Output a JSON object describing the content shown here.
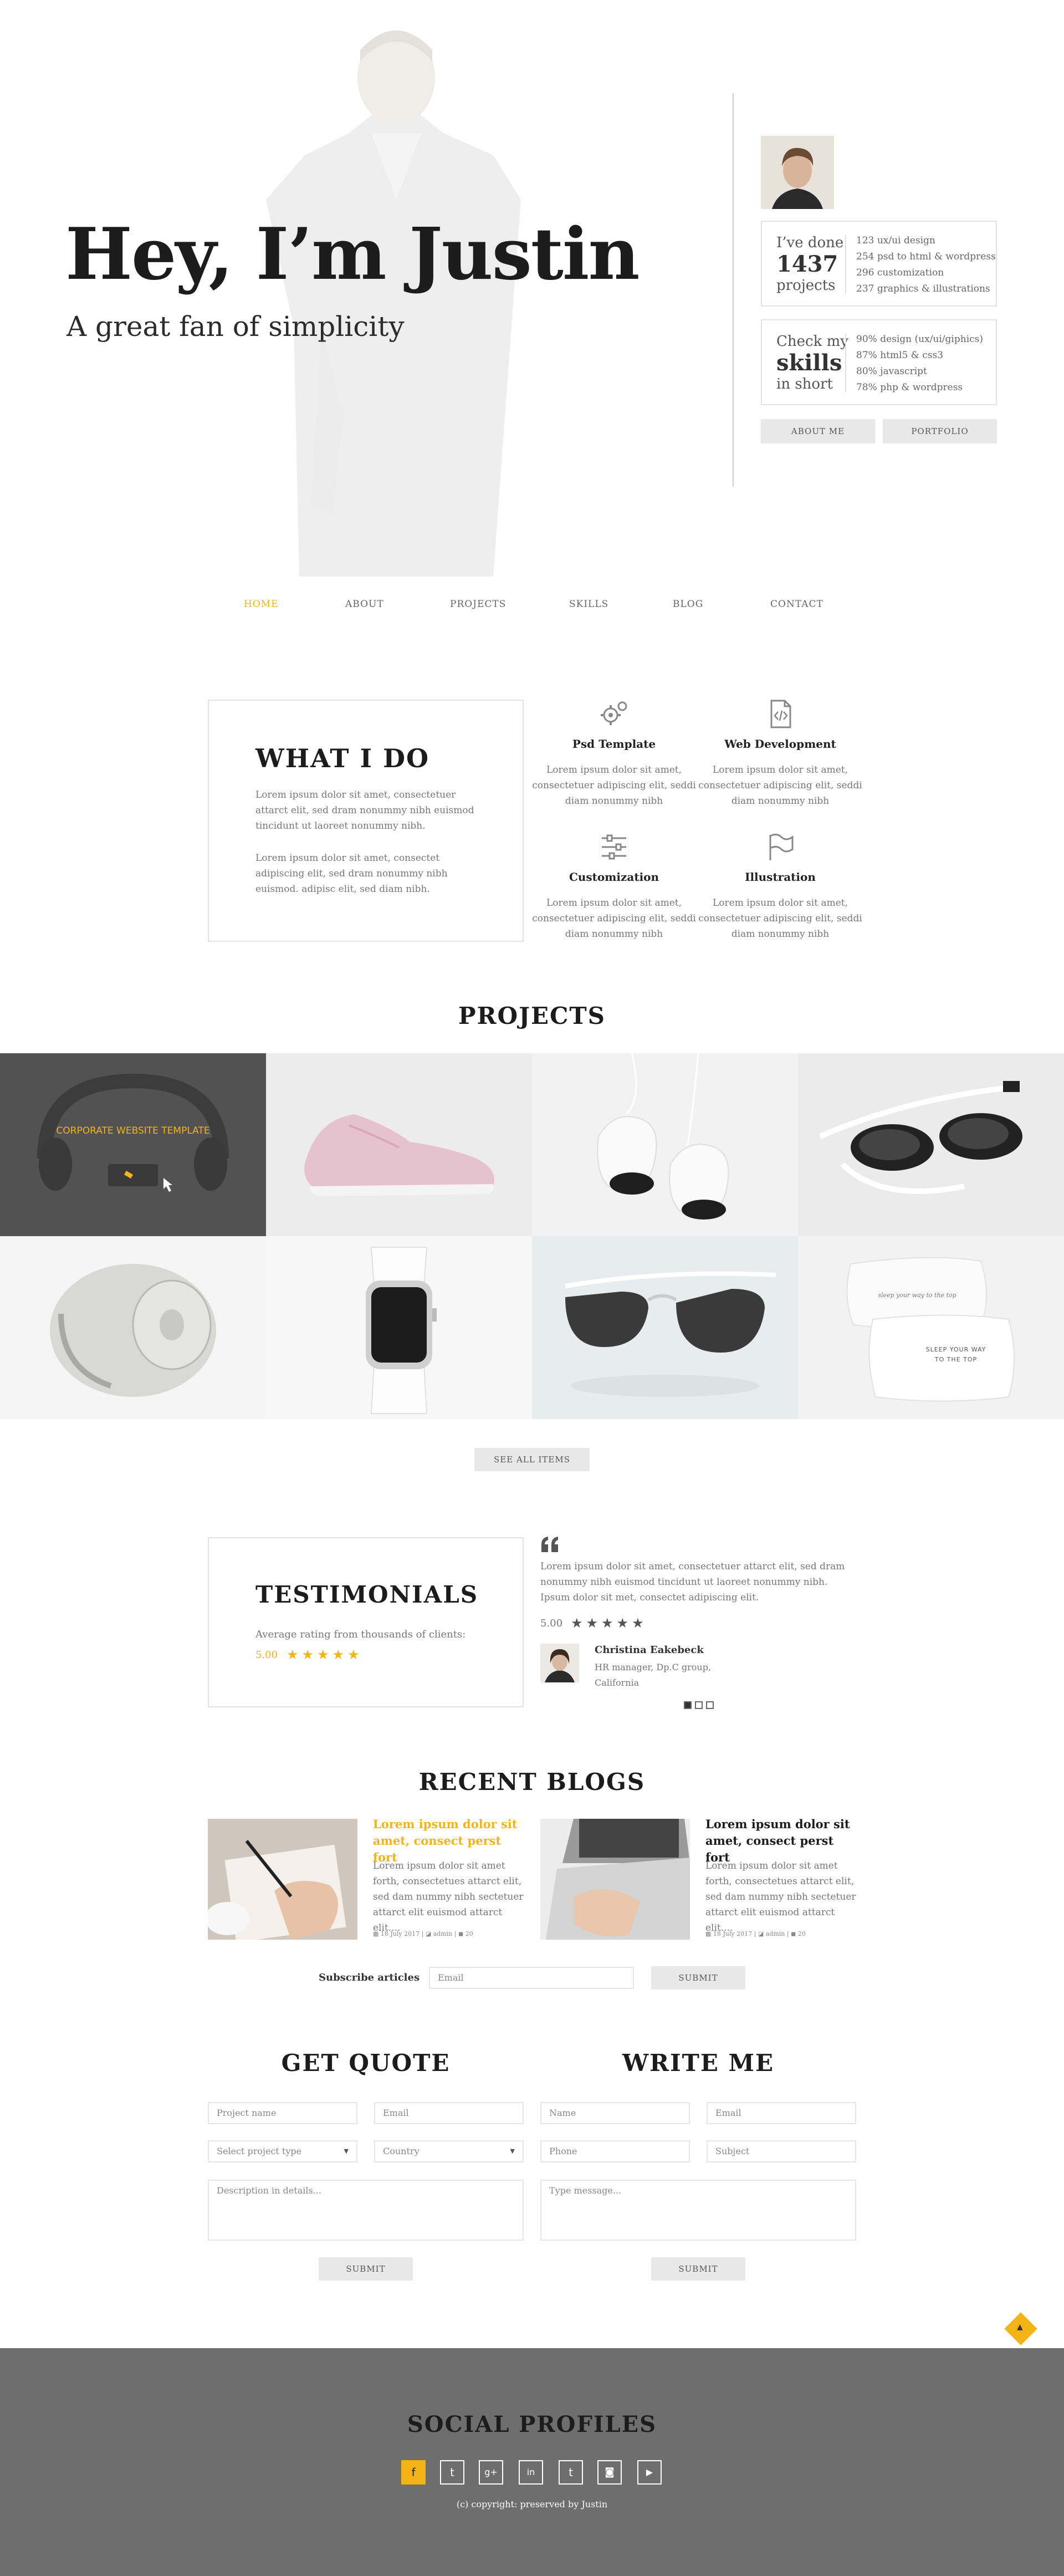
{
  "hero": {
    "title": "Hey, I’m Justin",
    "subtitle": "A great fan of simplicity",
    "done": {
      "prefix": "I’ve done",
      "count": "1437",
      "suffix": "projects",
      "items": [
        "123 ux/ui design",
        "254 psd to html & wordpress",
        "296 customization",
        "237 graphics & illustrations"
      ]
    },
    "skills": {
      "prefix": "Check my",
      "word": "skills",
      "suffix": "in short",
      "items": [
        "90% design (ux/ui/giphics)",
        "87% html5 & css3",
        "80% javascript",
        "78% php & wordpress"
      ]
    },
    "buttons": {
      "about": "ABOUT ME",
      "portfolio": "PORTFOLIO"
    }
  },
  "nav": [
    "HOME",
    "ABOUT",
    "PROJECTS",
    "SKILLS",
    "BLOG",
    "CONTACT"
  ],
  "what_i_do": {
    "title": "WHAT I DO",
    "p1": "Lorem ipsum dolor sit amet, consectetuer attarct elit, sed dram nonummy nibh euismod tincidunt ut laoreet nonummy nibh.",
    "p2": "Lorem ipsum dolor sit amet, consectet adipiscing elit, sed dram nonummy nibh euismod. adipisc elit, sed diam nibh.",
    "services": [
      {
        "icon": "gears-icon",
        "title": "Psd Template",
        "text": "Lorem ipsum dolor sit amet, consectetuer adipiscing elit, seddi diam nonummy nibh"
      },
      {
        "icon": "code-file-icon",
        "title": "Web Development",
        "text": "Lorem ipsum dolor sit amet, consectetuer adipiscing elit, seddi diam nonummy nibh"
      },
      {
        "icon": "sliders-icon",
        "title": "Customization",
        "text": "Lorem ipsum dolor sit amet, consectetuer adipiscing elit, seddi diam nonummy nibh"
      },
      {
        "icon": "flag-icon",
        "title": "Illustration",
        "text": "Lorem ipsum dolor sit amet, consectetuer adipiscing elit, seddi diam nonummy nibh"
      }
    ]
  },
  "projects": {
    "title": "PROJECTS",
    "overlay": "CORPORATE WEBSITE TEMPLATE",
    "pillow_text_small": "sleep your way to the top",
    "pillow_text_big": "SLEEP YOUR WAY TO THE TOP",
    "see_all": "SEE ALL ITEMS"
  },
  "testimonials": {
    "title": "TESTIMONIALS",
    "sub": "Average rating from thousands of clients:",
    "avg": "5.00",
    "stars": "★★★★★",
    "quote": "Lorem ipsum dolor sit amet, consectetuer attarct elit, sed dram nonummy nibh euismod tincidunt ut laoreet nonummy nibh. Ipsum dolor sit met, consectet adipiscing elit.",
    "rating": "5.00",
    "name": "Christina Eakebeck",
    "role": "HR manager, Dp.C group, California"
  },
  "blogs": {
    "title": "RECENT BLOGS",
    "posts": [
      {
        "title": "Lorem ipsum dolor sit amet, consect perst fort",
        "text": "Lorem ipsum dolor sit amet forth, consectetues attarct elit, sed dam nummy nibh sectetuer attarct elit euismod attarct elit....",
        "date": "18 July 2017",
        "author": "admin",
        "comments": "20"
      },
      {
        "title": "Lorem ipsum dolor sit amet, consect perst fort",
        "text": "Lorem ipsum dolor sit amet forth, consectetues attarct elit, sed dam nummy nibh sectetuer attarct elit euismod attarct elit....",
        "date": "18 July 2017",
        "author": "admin",
        "comments": "20"
      }
    ],
    "subscribe_label": "Subscribe articles",
    "subscribe_placeholder": "Email",
    "submit": "SUBMIT"
  },
  "quote_form": {
    "title": "GET QUOTE",
    "project_name": "Project name",
    "email": "Email",
    "project_type": "Select project type",
    "country": "Country",
    "description": "Description in details...",
    "submit": "SUBMIT"
  },
  "write_form": {
    "title": "WRITE ME",
    "name": "Name",
    "email": "Email",
    "phone": "Phone",
    "subject": "Subject",
    "message": "Type message...",
    "submit": "SUBMIT"
  },
  "footer": {
    "title": "SOCIAL PROFILES",
    "icons": [
      "facebook-icon",
      "twitter-icon",
      "google-plus-icon",
      "linkedin-icon",
      "tumblr-icon",
      "instagram-icon",
      "youtube-icon"
    ],
    "glyphs": [
      "f",
      "t",
      "g+",
      "in",
      "t",
      "◙",
      "▶"
    ],
    "copyright": "(c) copyright: preserved by Justin"
  },
  "colors": {
    "accent": "#f5b416",
    "footer_bg": "#6e6e6e",
    "heading": "#1c1c1c"
  }
}
